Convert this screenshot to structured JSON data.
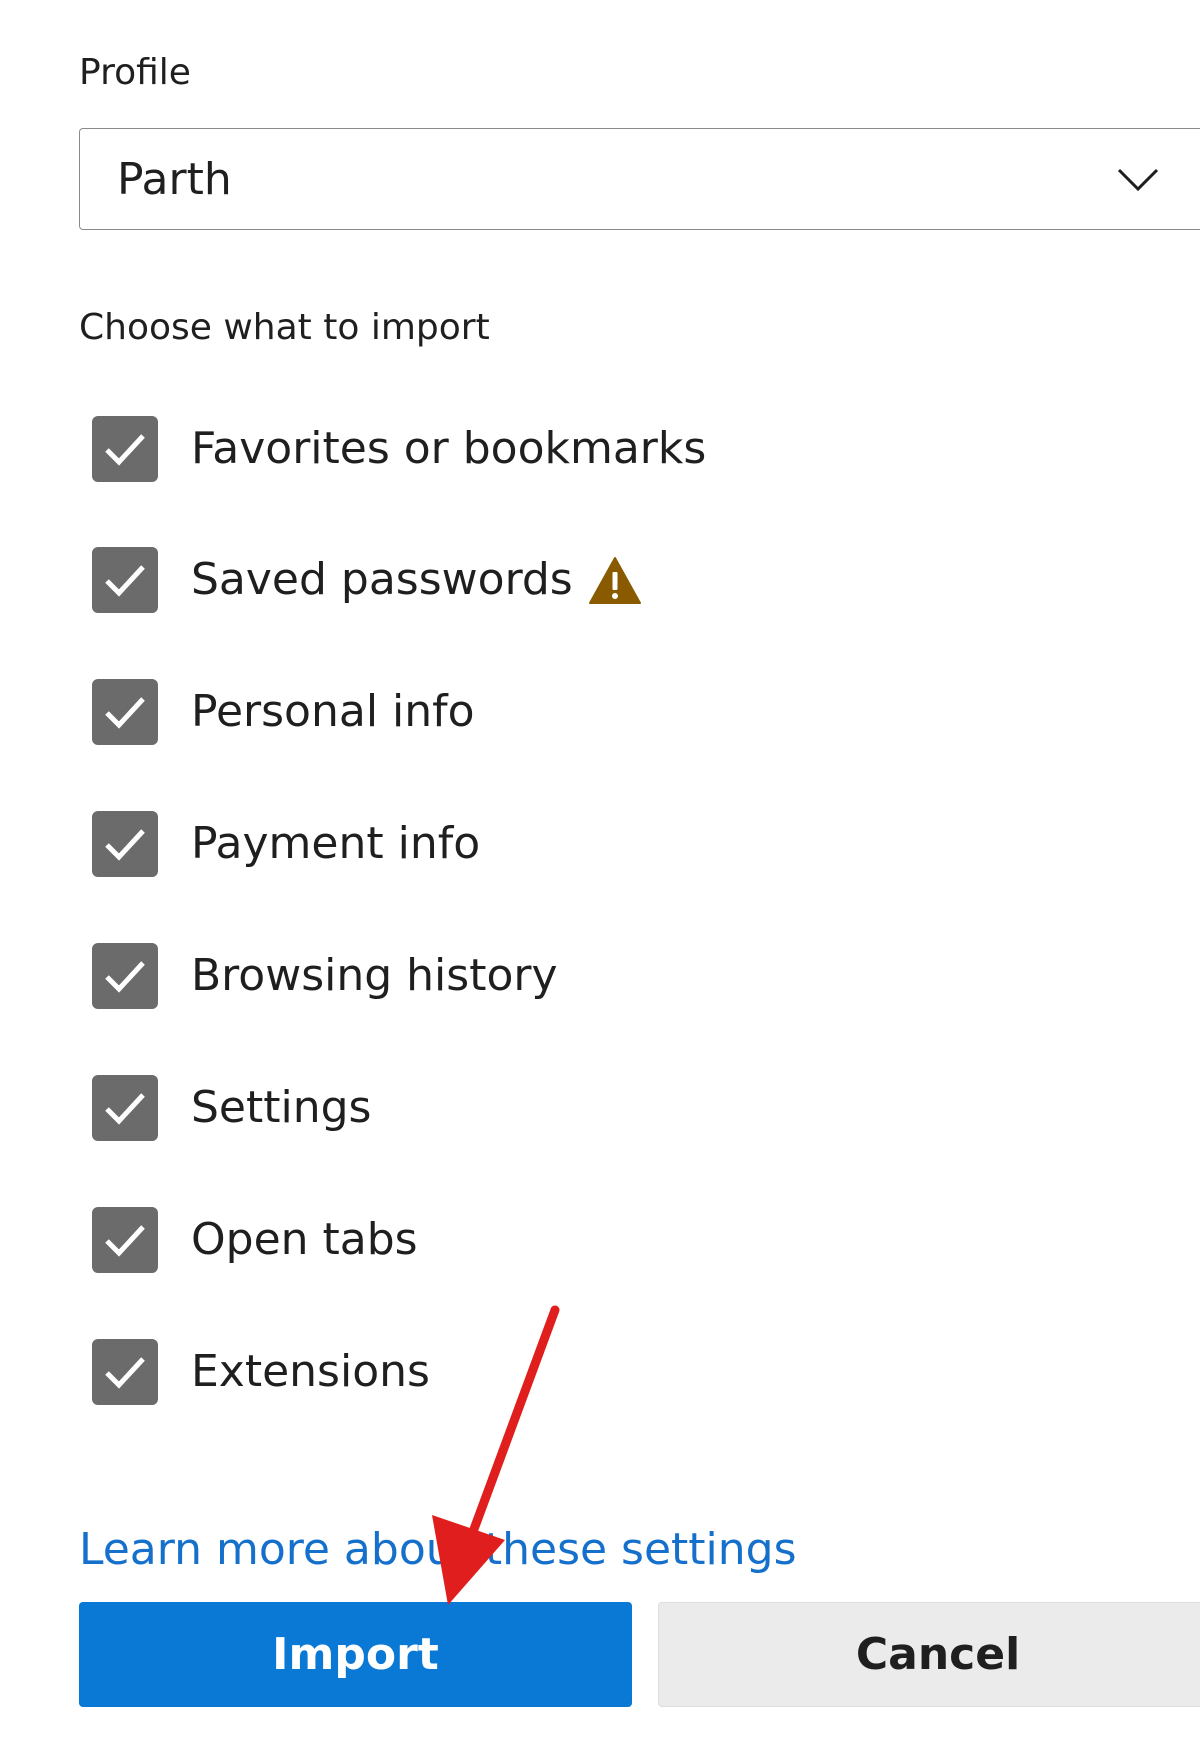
{
  "profile": {
    "label": "Profile",
    "selected": "Parth"
  },
  "import_section": {
    "label": "Choose what to import",
    "options": [
      {
        "label": "Favorites or bookmarks",
        "checked": true
      },
      {
        "label": "Saved passwords",
        "checked": true,
        "warning_icon": "warning-triangle-icon"
      },
      {
        "label": "Personal info",
        "checked": true
      },
      {
        "label": "Payment info",
        "checked": true
      },
      {
        "label": "Browsing history",
        "checked": true
      },
      {
        "label": "Settings",
        "checked": true
      },
      {
        "label": "Open tabs",
        "checked": true
      },
      {
        "label": "Extensions",
        "checked": true
      }
    ]
  },
  "footer": {
    "learn_more": "Learn more about these settings",
    "import_label": "Import",
    "cancel_label": "Cancel"
  },
  "colors": {
    "primary": "#0a78d5",
    "link": "#1570cc",
    "checkbox": "#6b6b6b",
    "warning": "#8a5a00",
    "annotation_arrow": "#e01e1e"
  }
}
